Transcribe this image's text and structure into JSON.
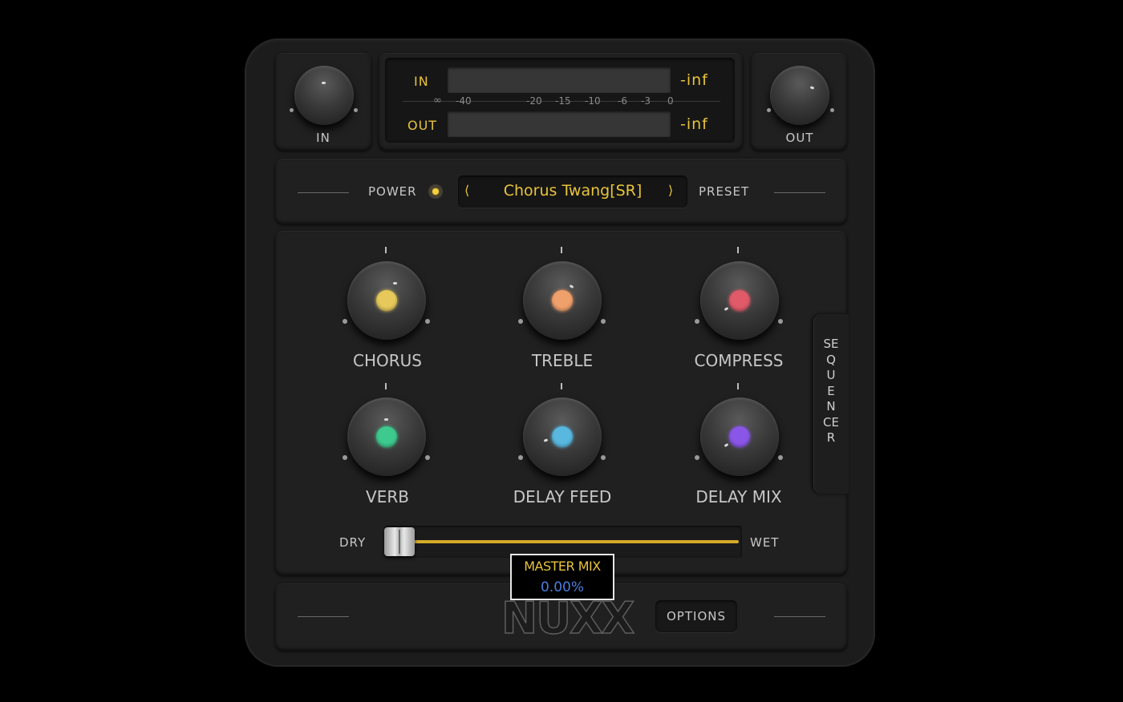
{
  "io": {
    "in_label": "IN",
    "out_label": "OUT"
  },
  "meter": {
    "in_label": "IN",
    "out_label": "OUT",
    "in_value": "-inf",
    "out_value": "-inf",
    "scale": [
      "∞",
      "-40",
      "-20",
      "-15",
      "-10",
      "-6",
      "-3",
      "0"
    ]
  },
  "preset_bar": {
    "power_label": "POWER",
    "preset_name": "Chorus Twang[SR]",
    "prev_arrow": "⟨",
    "next_arrow": "⟩",
    "preset_label": "PRESET"
  },
  "knobs": [
    {
      "label": "CHORUS",
      "color": "#e6c95a"
    },
    {
      "label": "TREBLE",
      "color": "#f0a06a"
    },
    {
      "label": "COMPRESS",
      "color": "#e05a6a"
    },
    {
      "label": "VERB",
      "color": "#3ec98e"
    },
    {
      "label": "DELAY FEED",
      "color": "#58b8e0"
    },
    {
      "label": "DELAY MIX",
      "color": "#8a56e8"
    }
  ],
  "sequencer_tab": "SEQUENCER",
  "mix": {
    "dry_label": "DRY",
    "wet_label": "WET",
    "tooltip_title": "MASTER MIX",
    "tooltip_value": "0.00%",
    "value_fraction": 0.0
  },
  "footer": {
    "logo": "NUXX",
    "options_label": "OPTIONS"
  },
  "colors": {
    "accent": "#e8c43c",
    "tooltip_value": "#4a7de0"
  }
}
